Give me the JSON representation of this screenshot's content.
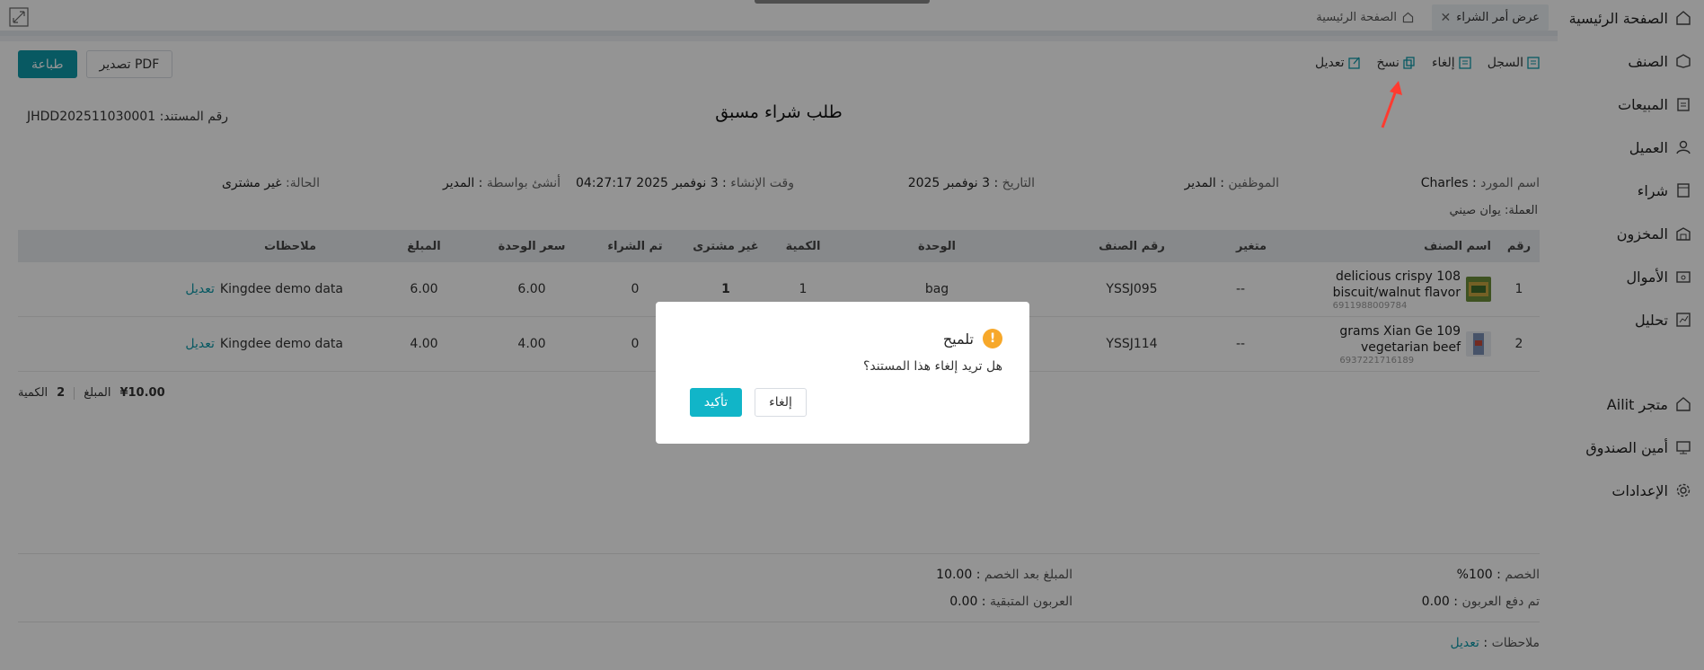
{
  "sidebar": {
    "items": [
      {
        "label": "الصفحة الرئيسية",
        "icon": "home-icon"
      },
      {
        "label": "الصنف",
        "icon": "box-icon"
      },
      {
        "label": "المبيعات",
        "icon": "clipboard-icon"
      },
      {
        "label": "العميل",
        "icon": "user-icon"
      },
      {
        "label": "شراء",
        "icon": "cart-icon"
      },
      {
        "label": "المخزون",
        "icon": "warehouse-icon"
      },
      {
        "label": "الأموال",
        "icon": "wallet-icon"
      },
      {
        "label": "تحليل",
        "icon": "chart-icon"
      },
      {
        "label": "متجر Ailit",
        "icon": "store-icon"
      },
      {
        "label": "أمين الصندوق",
        "icon": "monitor-icon"
      },
      {
        "label": "الإعدادات",
        "icon": "gear-icon"
      }
    ]
  },
  "tabs": [
    {
      "label": "الصفحة الرئيسية"
    },
    {
      "label": "عرض أمر الشراء"
    }
  ],
  "toolbar": {
    "print_label": "طباعة",
    "export_label": "تصدير PDF",
    "actions": [
      {
        "label": "تعديل",
        "icon": "edit-icon"
      },
      {
        "label": "نسخ",
        "icon": "copy-icon"
      },
      {
        "label": "إلغاء",
        "icon": "cancel-doc-icon"
      },
      {
        "label": "السجل",
        "icon": "log-icon"
      }
    ]
  },
  "document": {
    "title": "طلب شراء مسبق",
    "number_label": "رقم المستند:",
    "number": "JHDD202511030001",
    "supplier_label": "اسم المورد",
    "supplier": "Charles",
    "staff_label": "الموظفين",
    "staff": "المدير",
    "date_label": "التاريخ",
    "date": "3 نوفمبر 2025",
    "created_label": "وقت الإنشاء",
    "created": "3 نوفمبر 2025 04:27:17",
    "creator_label": "أنشئ بواسطة",
    "creator": "المدير",
    "status_label": "الحالة:",
    "status": "غير مشترى",
    "currency_label": "العملة:",
    "currency": "يوان صيني"
  },
  "table": {
    "headers": {
      "no": "رقم",
      "name": "اسم الصنف",
      "variant": "متغير",
      "code": "رقم الصنف",
      "unit": "الوحدة",
      "qty": "الكمية",
      "not_bought": "غير مشترى",
      "bought": "تم الشراء",
      "price": "سعر الوحدة",
      "amount": "المبلغ",
      "notes": "ملاحظات"
    },
    "rows": [
      {
        "no": "1",
        "name_line1": "delicious crispy 108",
        "name_line2": "biscuit/walnut flavor",
        "barcode": "6911988009784",
        "variant": "--",
        "code": "YSSJ095",
        "unit": "bag",
        "qty": "1",
        "not_bought": "1",
        "bought": "0",
        "price": "6.00",
        "amount": "6.00",
        "notes": "Kingdee demo data",
        "edit": "تعديل"
      },
      {
        "no": "2",
        "name_line1": "grams Xian Ge 109",
        "name_line2": "vegetarian beef",
        "barcode": "6937221716189",
        "variant": "--",
        "code": "YSSJ114",
        "unit": "",
        "qty": "",
        "not_bought": "",
        "bought": "0",
        "price": "4.00",
        "amount": "4.00",
        "notes": "Kingdee demo data",
        "edit": "تعديل"
      }
    ]
  },
  "totals": {
    "qty_label": "الكمية",
    "qty": "2",
    "amount_label": "المبلغ",
    "amount": "¥10.00"
  },
  "summary": {
    "discount_label": "الخصم",
    "discount": "100%",
    "after_discount_label": "المبلغ بعد الخصم",
    "after_discount": "10.00",
    "deposit_paid_label": "تم دفع العربون",
    "deposit_paid": "0.00",
    "deposit_remaining_label": "العربون المتبقية",
    "deposit_remaining": "0.00",
    "notes_label": "ملاحظات",
    "notes_edit": "تعديل"
  },
  "dialog": {
    "title": "تلميح",
    "message": "هل تريد إلغاء هذا المستند؟",
    "cancel_label": "إلغاء",
    "confirm_label": "تأكيد"
  },
  "colors": {
    "accent": "#0f9aaa",
    "warning": "#f7a82a",
    "annotation_arrow": "#ff3b30"
  }
}
